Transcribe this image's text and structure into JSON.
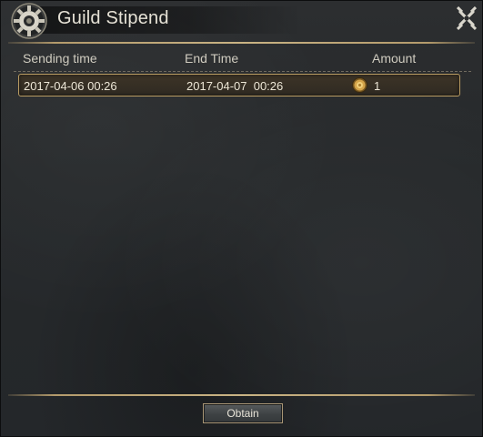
{
  "window": {
    "title": "Guild Stipend",
    "icon": "gear-emblem-icon",
    "close_icon": "close-icon"
  },
  "table": {
    "headers": {
      "sending_time": "Sending time",
      "end_time": "End Time",
      "amount": "Amount"
    },
    "rows": [
      {
        "sending_time": "2017-04-06 00:26",
        "end_time": "2017-04-07  00:26",
        "amount_icon": "gold-coin-icon",
        "amount": "1"
      }
    ]
  },
  "footer": {
    "obtain_label": "Obtain"
  },
  "colors": {
    "accent_gold": "#b89b62",
    "panel_bg": "#2a2d2f",
    "text": "#e6e2d6"
  }
}
